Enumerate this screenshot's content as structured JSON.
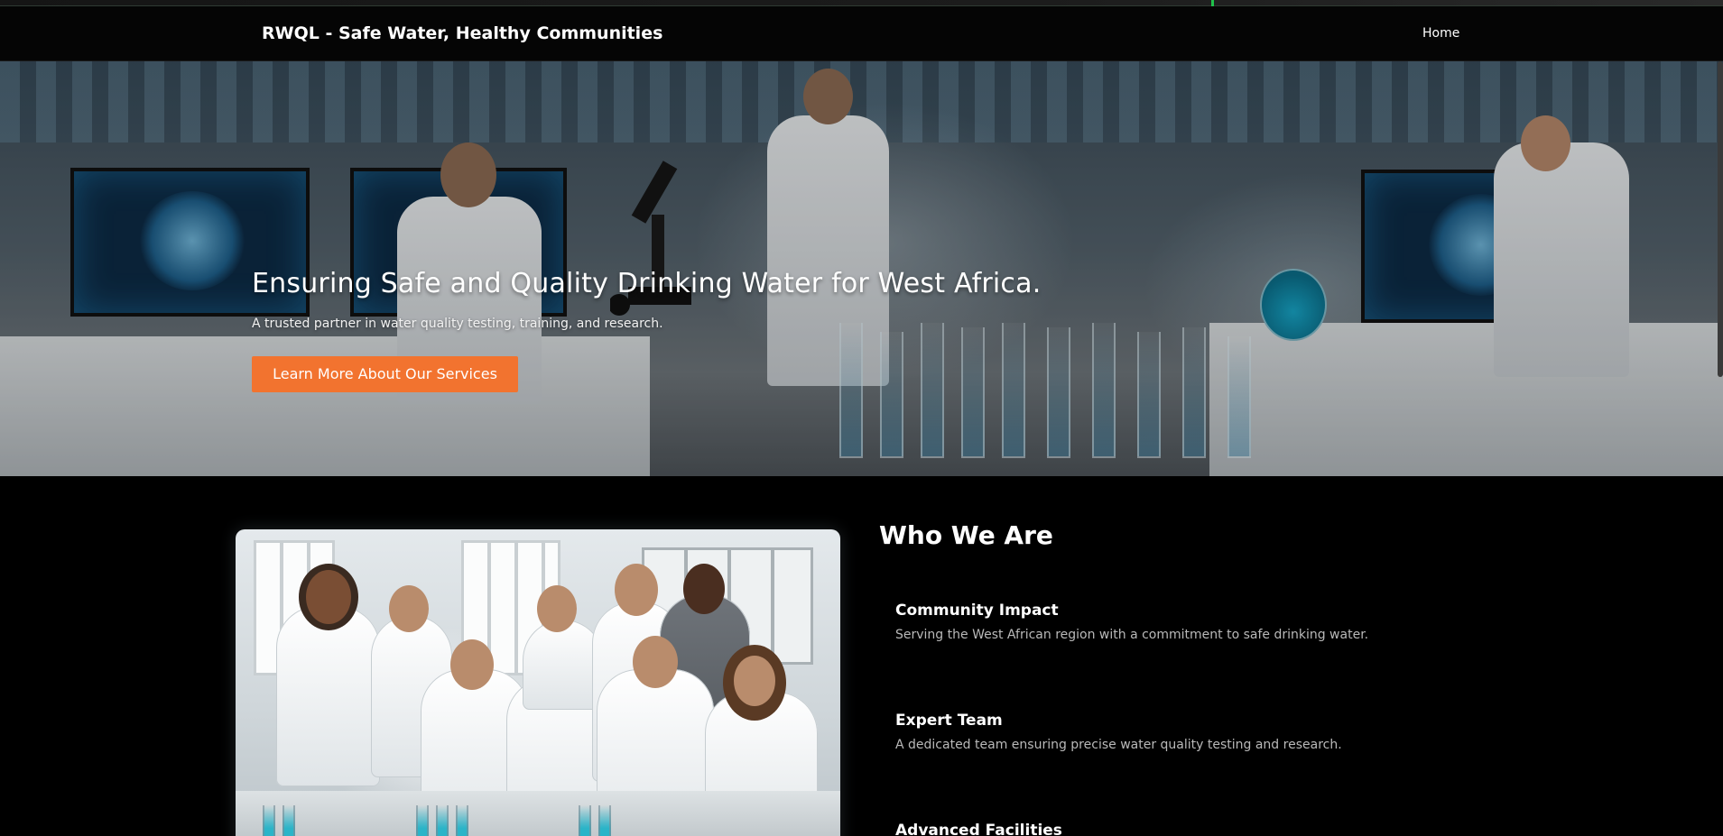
{
  "nav": {
    "brand": "RWQL - Safe Water, Healthy Communities",
    "home": "Home"
  },
  "hero": {
    "title": "Ensuring Safe and Quality Drinking Water for West Africa.",
    "subtitle": "A trusted partner in water quality testing, training, and research.",
    "cta": "Learn More About Our Services"
  },
  "about": {
    "title": "Who We Are",
    "features": [
      {
        "title": "Community Impact",
        "text": "Serving the West African region with a commitment to safe drinking water."
      },
      {
        "title": "Expert Team",
        "text": "A dedicated team ensuring precise water quality testing and research."
      },
      {
        "title": "Advanced Facilities",
        "text": ""
      }
    ]
  },
  "colors": {
    "accent": "#f2732f",
    "background": "#000000",
    "text_muted": "#b9b9b9"
  }
}
